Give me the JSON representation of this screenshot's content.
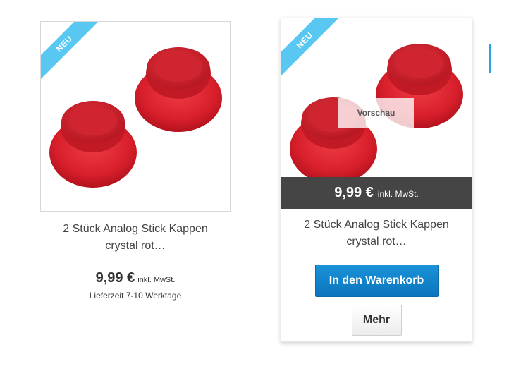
{
  "products": [
    {
      "badge": "NEU",
      "title_line1": "2 Stück Analog Stick Kappen",
      "title_line2": "crystal rot…",
      "price": "9,99 €",
      "tax_note": "inkl. MwSt.",
      "delivery": "Lieferzeit 7-10 Werktage"
    },
    {
      "badge": "NEU",
      "preview_label": "Vorschau",
      "price": "9,99 €",
      "tax_note": "inkl. MwSt.",
      "title_line1": "2 Stück Analog Stick Kappen",
      "title_line2": "crystal rot…",
      "cart_button": "In den Warenkorb",
      "more_button": "Mehr"
    }
  ],
  "colors": {
    "badge": "#58c8f3",
    "cart_button": "#0b75bd",
    "price_bar": "#454545",
    "product_red": "#d8232f"
  },
  "icons": {
    "product_image": "red-analog-stick-caps"
  }
}
